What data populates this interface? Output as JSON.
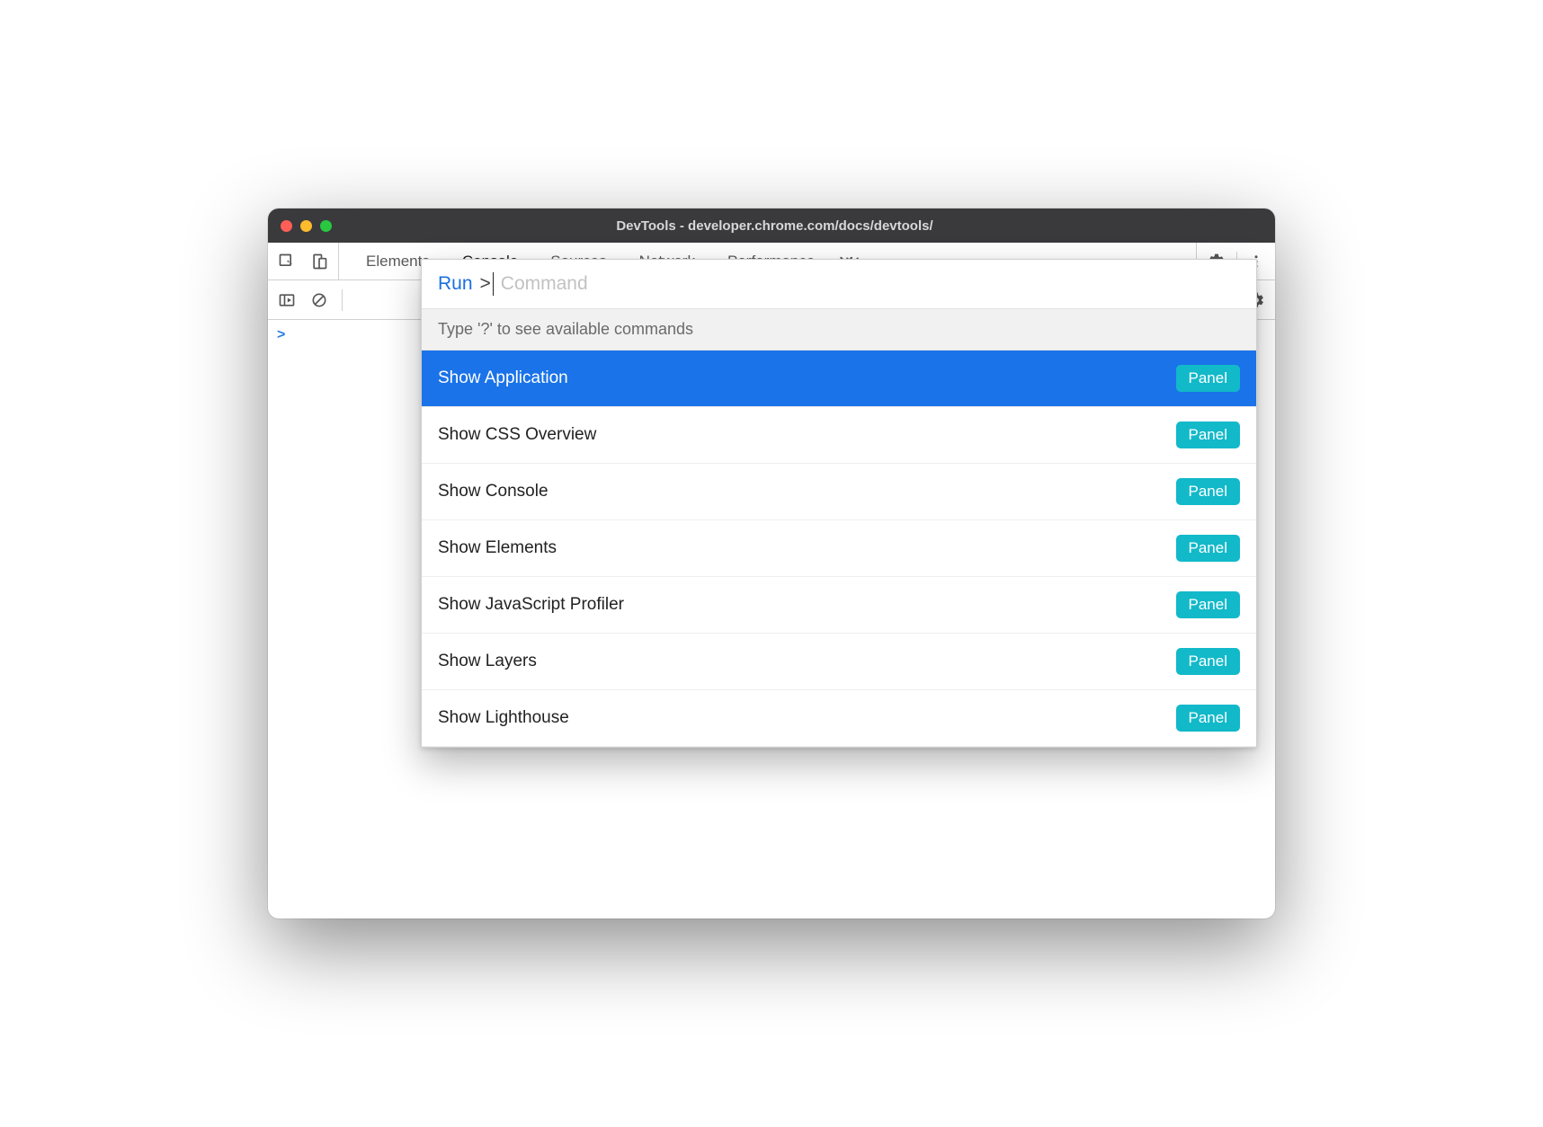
{
  "window": {
    "title": "DevTools - developer.chrome.com/docs/devtools/"
  },
  "toolbar": {
    "tabs": [
      {
        "label": "Elements",
        "active": false
      },
      {
        "label": "Console",
        "active": true
      },
      {
        "label": "Sources",
        "active": false
      },
      {
        "label": "Network",
        "active": false
      },
      {
        "label": "Performance",
        "active": false
      }
    ]
  },
  "console": {
    "prompt": ">"
  },
  "palette": {
    "prefix_label": "Run",
    "prefix_symbol": ">",
    "placeholder": "Command",
    "hint": "Type '?' to see available commands",
    "badge_label": "Panel",
    "results": [
      {
        "label": "Show Application",
        "badge": "Panel",
        "selected": true
      },
      {
        "label": "Show CSS Overview",
        "badge": "Panel",
        "selected": false
      },
      {
        "label": "Show Console",
        "badge": "Panel",
        "selected": false
      },
      {
        "label": "Show Elements",
        "badge": "Panel",
        "selected": false
      },
      {
        "label": "Show JavaScript Profiler",
        "badge": "Panel",
        "selected": false
      },
      {
        "label": "Show Layers",
        "badge": "Panel",
        "selected": false
      },
      {
        "label": "Show Lighthouse",
        "badge": "Panel",
        "selected": false
      }
    ]
  }
}
